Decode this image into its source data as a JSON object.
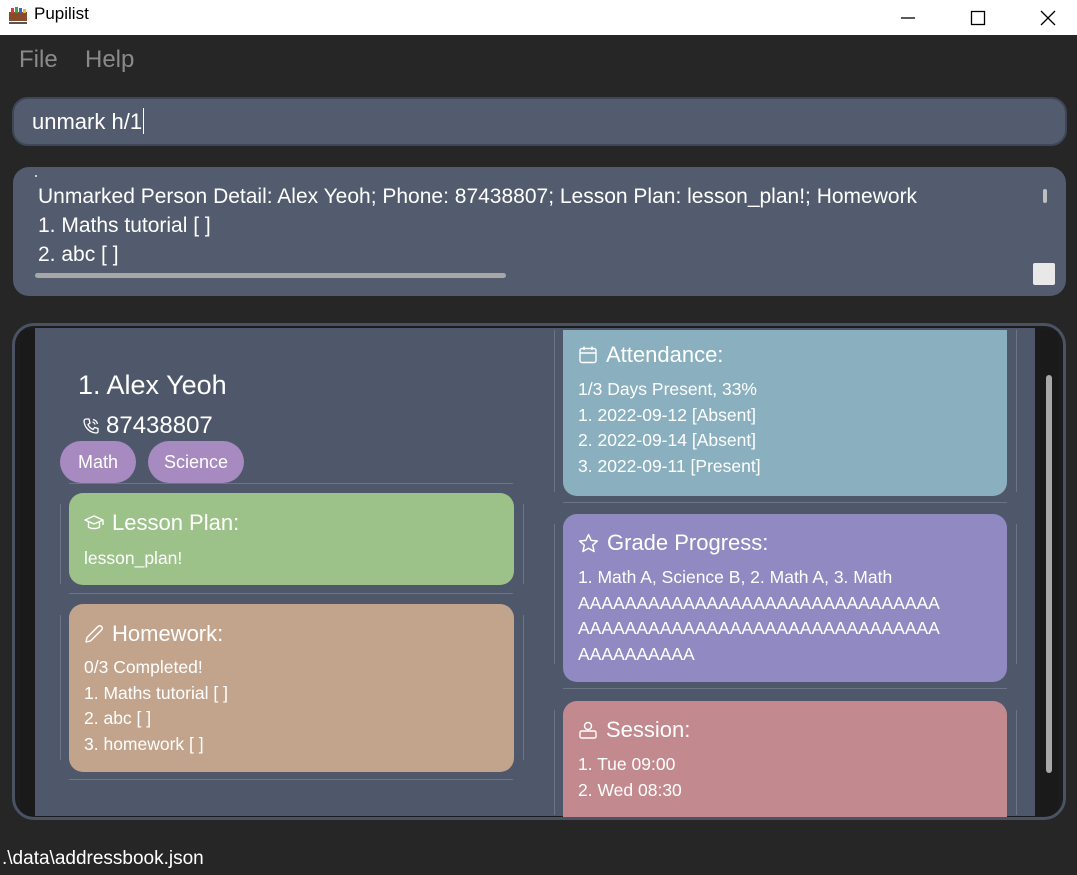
{
  "window": {
    "title": "Pupilist",
    "minimize_icon": "minimize-icon",
    "maximize_icon": "maximize-icon",
    "close_icon": "close-icon"
  },
  "menu": {
    "items": [
      {
        "label": "File"
      },
      {
        "label": "Help"
      }
    ]
  },
  "command": {
    "value": "unmark h/1"
  },
  "result": {
    "lines": [
      "Unmarked Person Detail: Alex Yeoh; Phone: 87438807; Lesson Plan: lesson_plan!; Homework",
      "1. Maths tutorial [ ]",
      "2. abc [ ]"
    ]
  },
  "person": {
    "index_name": "1.  Alex Yeoh",
    "phone": "87438807",
    "tags": [
      "Math",
      "Science"
    ],
    "lesson_plan": {
      "title": "Lesson Plan:",
      "body": "lesson_plan!",
      "icon": "graduation-cap-icon",
      "color": "#9cc28a"
    },
    "homework": {
      "title": "Homework:",
      "body": "0/3 Completed!\n1. Maths tutorial [ ]\n2. abc [ ]\n3. homework [ ]",
      "icon": "pencil-icon",
      "color": "#c2a48c"
    },
    "attendance": {
      "title": "Attendance:",
      "body": "1/3 Days Present, 33%\n1. 2022-09-12 [Absent]\n2. 2022-09-14 [Absent]\n3. 2022-09-11 [Present]",
      "icon": "calendar-icon",
      "color": "#8ab0bf"
    },
    "grade_progress": {
      "title": "Grade Progress:",
      "body": "1. Math A, Science B, 2. Math A, 3. Math\nAAAAAAAAAAAAAAAAAAAAAAAAAAAAAAA\nAAAAAAAAAAAAAAAAAAAAAAAAAAAAAAA\nAAAAAAAAAA",
      "icon": "star-icon",
      "color": "#9189c2"
    },
    "session": {
      "title": "Session:",
      "body": "1. Tue 09:00\n2. Wed 08:30",
      "icon": "session-icon",
      "color": "#c28a8e"
    }
  },
  "status": {
    "path": ".\\data\\addressbook.json"
  }
}
